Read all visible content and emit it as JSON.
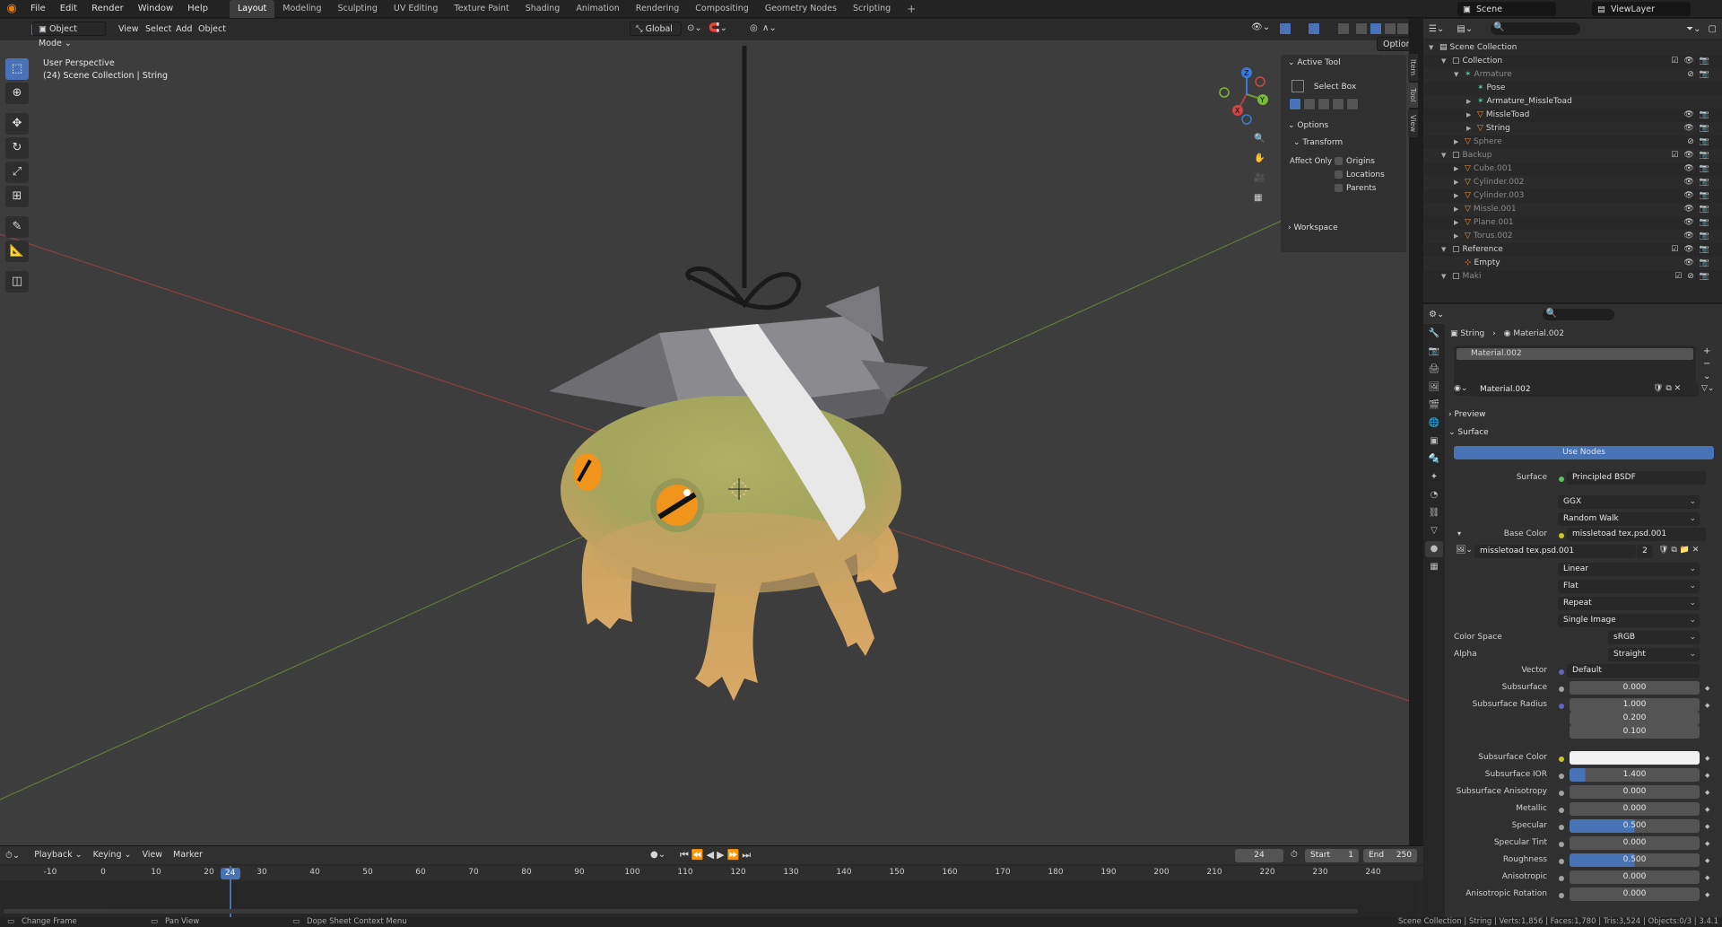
{
  "topbar": {
    "menus": [
      "File",
      "Edit",
      "Render",
      "Window",
      "Help"
    ],
    "tabs": [
      "Layout",
      "Modeling",
      "Sculpting",
      "UV Editing",
      "Texture Paint",
      "Shading",
      "Animation",
      "Rendering",
      "Compositing",
      "Geometry Nodes",
      "Scripting"
    ],
    "active_tab": "Layout",
    "add_tab": "+",
    "scene": "Scene",
    "view_layer": "ViewLayer"
  },
  "viewport": {
    "mode": "Object Mode",
    "menus": [
      "View",
      "Select",
      "Add",
      "Object"
    ],
    "orientation": "Global",
    "options_label": "Options",
    "info_line1": "User Perspective",
    "info_line2": "(24) Scene Collection | String",
    "gizmo_axes": {
      "x": "X",
      "y": "Y",
      "z": "Z"
    }
  },
  "npanel": {
    "tabs": [
      "Item",
      "Tool",
      "View"
    ],
    "active_tool_header": "Active Tool",
    "active_tool": "Select Box",
    "options_header": "Options",
    "transform_header": "Transform",
    "affect_only": "Affect Only",
    "checks": [
      "Origins",
      "Locations",
      "Parents"
    ],
    "workspace_header": "Workspace"
  },
  "outliner": {
    "rows": [
      {
        "name": "Scene Collection",
        "indent": 0,
        "type": "scene",
        "dim": false,
        "vis": ""
      },
      {
        "name": "Collection",
        "indent": 1,
        "type": "collection",
        "dim": false,
        "vis": "☑👁📷"
      },
      {
        "name": "Armature",
        "indent": 2,
        "type": "armature",
        "dim": true,
        "vis": "⊘📷"
      },
      {
        "name": "Pose",
        "indent": 3,
        "type": "pose",
        "dim": false,
        "vis": ""
      },
      {
        "name": "Armature_MissleToad",
        "indent": 3,
        "type": "armature",
        "dim": false,
        "vis": ""
      },
      {
        "name": "MissleToad",
        "indent": 3,
        "type": "object",
        "dim": false,
        "vis": "👁📷"
      },
      {
        "name": "String",
        "indent": 3,
        "type": "object",
        "dim": false,
        "vis": "👁📷"
      },
      {
        "name": "Sphere",
        "indent": 2,
        "type": "object",
        "dim": true,
        "vis": "⊘📷"
      },
      {
        "name": "Backup",
        "indent": 1,
        "type": "collection",
        "dim": true,
        "vis": "☑👁📷"
      },
      {
        "name": "Cube.001",
        "indent": 2,
        "type": "object",
        "dim": true,
        "vis": "👁📷"
      },
      {
        "name": "Cylinder.002",
        "indent": 2,
        "type": "object",
        "dim": true,
        "vis": "👁📷"
      },
      {
        "name": "Cylinder.003",
        "indent": 2,
        "type": "object",
        "dim": true,
        "vis": "👁📷"
      },
      {
        "name": "Missle.001",
        "indent": 2,
        "type": "object",
        "dim": true,
        "vis": "👁📷"
      },
      {
        "name": "Plane.001",
        "indent": 2,
        "type": "object",
        "dim": true,
        "vis": "👁📷"
      },
      {
        "name": "Torus.002",
        "indent": 2,
        "type": "object",
        "dim": true,
        "vis": "👁📷"
      },
      {
        "name": "Reference",
        "indent": 1,
        "type": "collection",
        "dim": false,
        "vis": "☑👁📷"
      },
      {
        "name": "Empty",
        "indent": 2,
        "type": "empty",
        "dim": false,
        "vis": "👁📷"
      },
      {
        "name": "Maki",
        "indent": 1,
        "type": "collection",
        "dim": true,
        "vis": "☑⊘📷"
      }
    ]
  },
  "properties": {
    "breadcrumb_object": "String",
    "breadcrumb_material": "Material.002",
    "slot": "Material.002",
    "material_name": "Material.002",
    "preview": "Preview",
    "surface_section": "Surface",
    "use_nodes": "Use Nodes",
    "surface_label": "Surface",
    "surface_value": "Principled BSDF",
    "dist": "GGX",
    "sss_method": "Random Walk",
    "base_color_label": "Base Color",
    "base_color_value": "missletoad tex.psd.001",
    "image_name": "missletoad tex.psd.001",
    "image_users": "2",
    "interp": "Linear",
    "projection": "Flat",
    "extension": "Repeat",
    "source": "Single Image",
    "color_space_label": "Color Space",
    "color_space": "sRGB",
    "alpha_label": "Alpha",
    "alpha": "Straight",
    "vector_label": "Vector",
    "vector": "Default",
    "subsurface_label": "Subsurface",
    "subsurface": "0.000",
    "sss_radius_label": "Subsurface Radius",
    "sss_radius": [
      "1.000",
      "0.200",
      "0.100"
    ],
    "sss_color_label": "Subsurface Color",
    "sss_ior_label": "Subsurface IOR",
    "sss_ior": "1.400",
    "sss_aniso_label": "Subsurface Anisotropy",
    "sss_aniso": "0.000",
    "metallic_label": "Metallic",
    "metallic": "0.000",
    "specular_label": "Specular",
    "specular": "0.500",
    "spec_tint_label": "Specular Tint",
    "spec_tint": "0.000",
    "roughness_label": "Roughness",
    "roughness": "0.500",
    "anisotropic_label": "Anisotropic",
    "anisotropic": "0.000",
    "aniso_rot_label": "Anisotropic Rotation",
    "aniso_rot": "0.000"
  },
  "timeline": {
    "menus": [
      "Playback",
      "Keying",
      "View",
      "Marker"
    ],
    "current_frame": "24",
    "start_label": "Start",
    "start": "1",
    "end_label": "End",
    "end": "250",
    "ticks": [
      "-10",
      "0",
      "10",
      "20",
      "30",
      "40",
      "50",
      "60",
      "70",
      "80",
      "90",
      "100",
      "110",
      "120",
      "130",
      "140",
      "150",
      "160",
      "170",
      "180",
      "190",
      "200",
      "210",
      "220",
      "230",
      "240"
    ]
  },
  "status": {
    "left1": "Change Frame",
    "left2": "Pan View",
    "left3": "Dope Sheet Context Menu",
    "right": "Scene Collection | String | Verts:1,856 | Faces:1,780 | Tris:3,524 | Objects:0/3 | 3.4.1"
  },
  "colors": {
    "accent": "#4772b3",
    "blender_orange": "#e87d0d",
    "toad_green": "#a3a55d",
    "toad_belly": "#d9a866",
    "missile_gray": "#8b8b8f",
    "x_axis": "#b34040",
    "y_axis": "#6c9a32"
  }
}
